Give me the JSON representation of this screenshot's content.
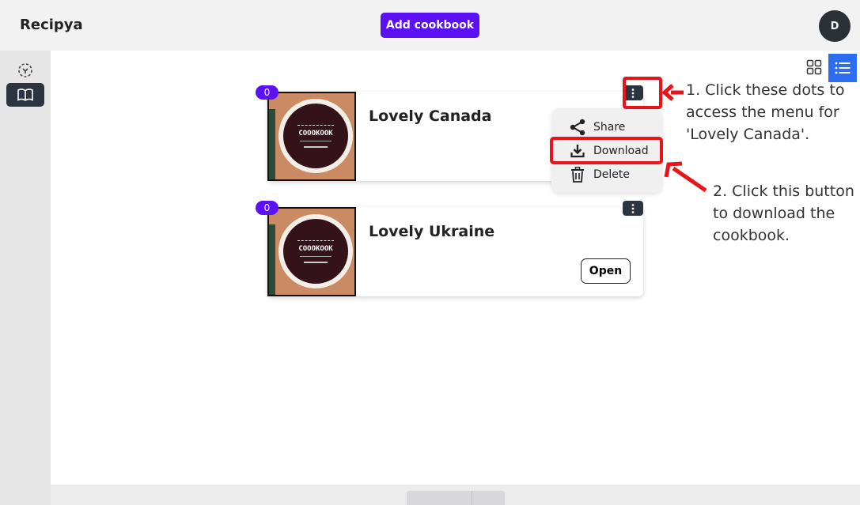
{
  "header": {
    "brand": "Recipya",
    "add_cookbook_label": "Add cookbook",
    "avatar_initial": "D"
  },
  "sidebar": {
    "items": [
      {
        "icon": "magic-select-icon",
        "active": false
      },
      {
        "icon": "book-open-icon",
        "active": true
      }
    ]
  },
  "view_toggle": {
    "grid_icon": "grid-icon",
    "list_icon": "list-icon",
    "active": "list"
  },
  "cookbooks": [
    {
      "title": "Lovely Canada",
      "count": "0",
      "cover_text": "COOOKOOK"
    },
    {
      "title": "Lovely Ukraine",
      "count": "0",
      "cover_text": "COOOKOOK",
      "open_label": "Open"
    }
  ],
  "context_menu": {
    "items": [
      {
        "label": "Share",
        "icon": "share-icon"
      },
      {
        "label": "Download",
        "icon": "download-icon"
      },
      {
        "label": "Delete",
        "icon": "trash-icon"
      }
    ]
  },
  "annotations": {
    "step1": "1. Click these dots to access the menu for 'Lovely Canada'.",
    "step2": "2. Click this button to download the cookbook."
  },
  "colors": {
    "accent": "#5b10f5",
    "highlight": "#e8141a",
    "list_toggle": "#2f6df0",
    "dark": "#2b3440"
  }
}
